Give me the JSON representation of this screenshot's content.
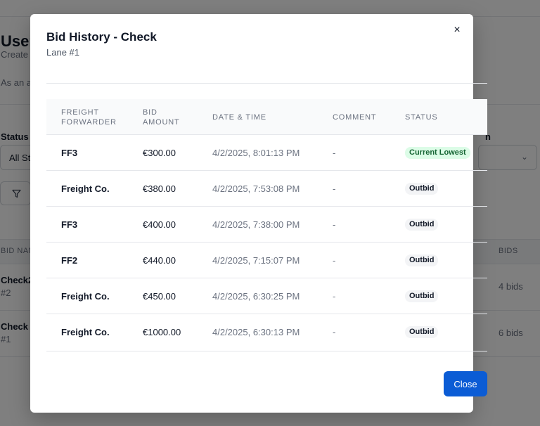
{
  "background": {
    "title": "User",
    "subtitle": "Create",
    "description": "As an a",
    "status_label": "Status",
    "status_value": "All St",
    "right_label": "n",
    "table_header_left": "BID NAME",
    "table_header_right": "BIDS",
    "rows": [
      {
        "name": "Check2",
        "sub": "#2",
        "bids": "4 bids"
      },
      {
        "name": "Check",
        "sub": "#1",
        "bids": "6 bids"
      }
    ]
  },
  "modal": {
    "title": "Bid History - Check",
    "subtitle": "Lane #1",
    "close_icon": "×",
    "close_button": "Close",
    "columns": {
      "forwarder": "FREIGHT FORWARDER",
      "amount": "BID AMOUNT",
      "datetime": "DATE & TIME",
      "comment": "COMMENT",
      "status": "STATUS"
    },
    "rows": [
      {
        "forwarder": "FF3",
        "amount": "€300.00",
        "datetime": "4/2/2025, 8:01:13 PM",
        "comment": "-",
        "status": "Current Lowest",
        "status_type": "lowest"
      },
      {
        "forwarder": "Freight Co.",
        "amount": "€380.00",
        "datetime": "4/2/2025, 7:53:08 PM",
        "comment": "-",
        "status": "Outbid",
        "status_type": "outbid"
      },
      {
        "forwarder": "FF3",
        "amount": "€400.00",
        "datetime": "4/2/2025, 7:38:00 PM",
        "comment": "-",
        "status": "Outbid",
        "status_type": "outbid"
      },
      {
        "forwarder": "FF2",
        "amount": "€440.00",
        "datetime": "4/2/2025, 7:15:07 PM",
        "comment": "-",
        "status": "Outbid",
        "status_type": "outbid"
      },
      {
        "forwarder": "Freight Co.",
        "amount": "€450.00",
        "datetime": "4/2/2025, 6:30:25 PM",
        "comment": "-",
        "status": "Outbid",
        "status_type": "outbid"
      },
      {
        "forwarder": "Freight Co.",
        "amount": "€1000.00",
        "datetime": "4/2/2025, 6:30:13 PM",
        "comment": "-",
        "status": "Outbid",
        "status_type": "outbid"
      }
    ]
  },
  "colors": {
    "primary": "#0b5cd5",
    "lowest_bg": "#dcfce7",
    "lowest_text": "#166534",
    "outbid_bg": "#f3f4f6"
  }
}
